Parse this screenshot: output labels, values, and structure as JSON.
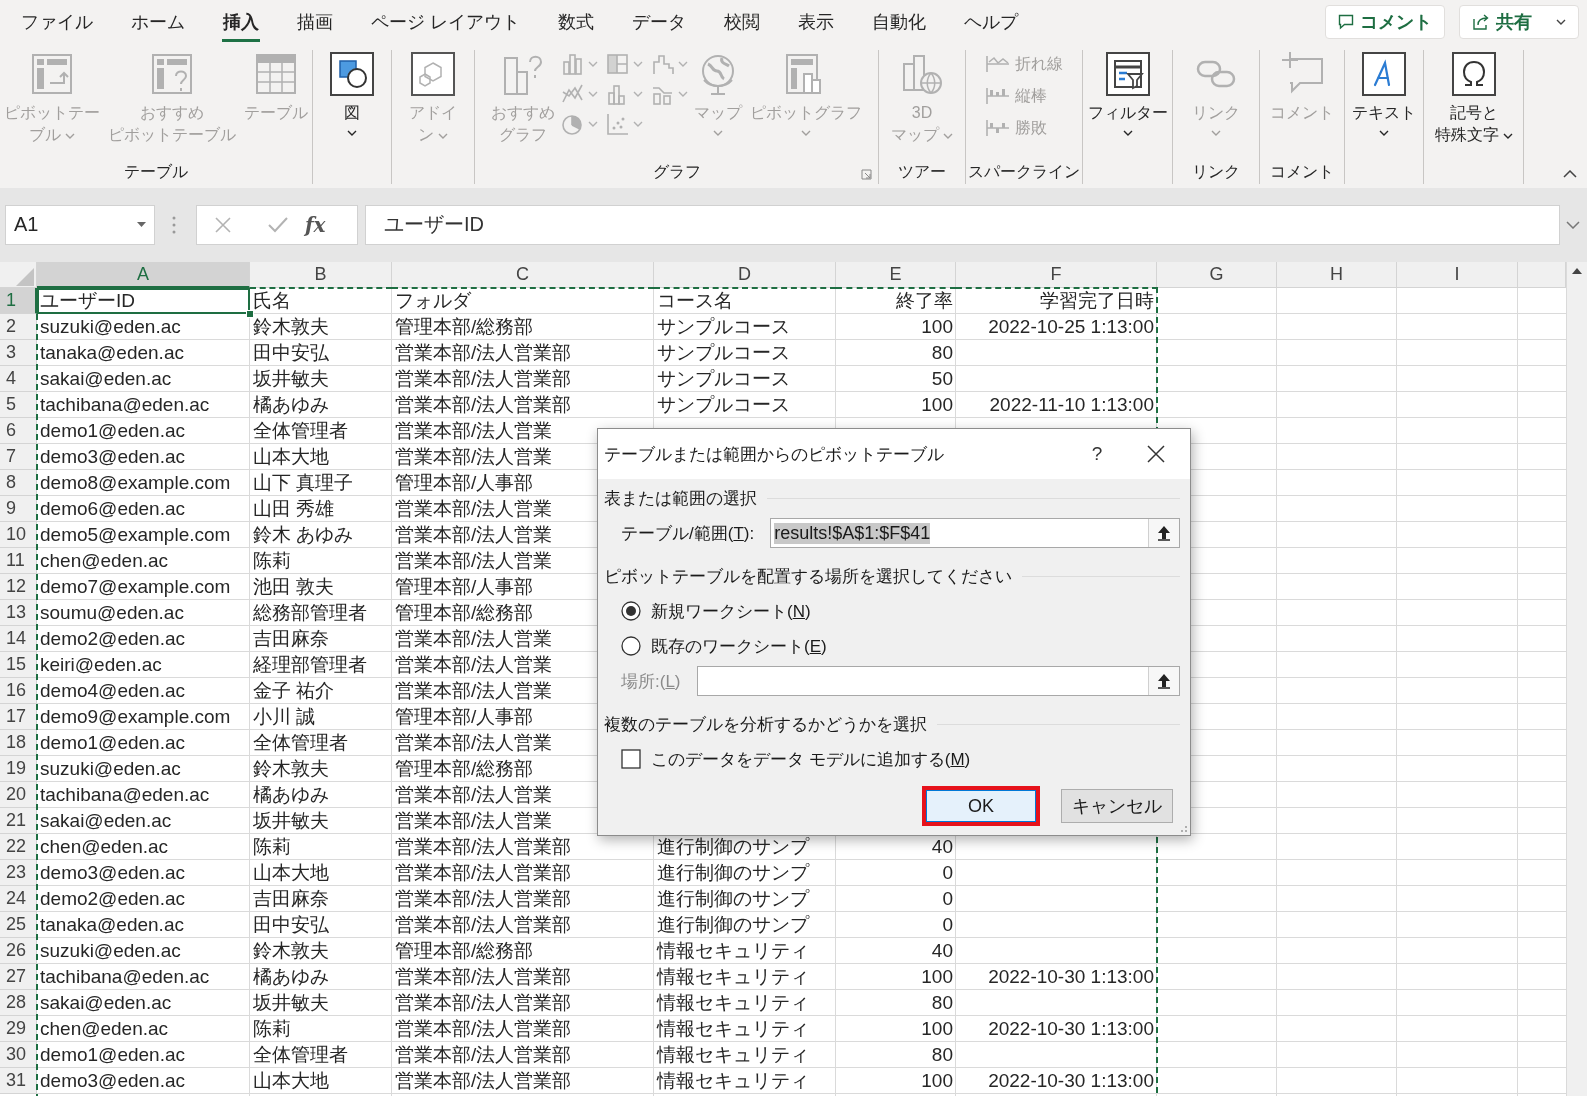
{
  "ribbon_tabs": [
    {
      "label": "ファイル",
      "selected": false
    },
    {
      "label": "ホーム",
      "selected": false
    },
    {
      "label": "挿入",
      "selected": true
    },
    {
      "label": "描画",
      "selected": false
    },
    {
      "label": "ページ レイアウト",
      "selected": false
    },
    {
      "label": "数式",
      "selected": false
    },
    {
      "label": "データ",
      "selected": false
    },
    {
      "label": "校閲",
      "selected": false
    },
    {
      "label": "表示",
      "selected": false
    },
    {
      "label": "自動化",
      "selected": false
    },
    {
      "label": "ヘルプ",
      "selected": false
    }
  ],
  "header_buttons": [
    {
      "kind": "comment",
      "label": "コメント",
      "dropdown": false
    },
    {
      "kind": "share",
      "label": "共有",
      "dropdown": true
    }
  ],
  "ribbon": {
    "groups": [
      {
        "label": "テーブル",
        "items": [
          {
            "kind": "large_inline",
            "label_lines": [
              "ピボットテー",
              "ブル"
            ],
            "dropdown": true,
            "disabled": true
          },
          {
            "kind": "large",
            "label_lines": [
              "おすすめ",
              "ピボットテーブル"
            ],
            "disabled": true
          },
          {
            "kind": "large",
            "label_lines": [
              "テーブル"
            ],
            "disabled": true
          }
        ]
      },
      {
        "items": [
          {
            "kind": "large",
            "label_lines": [
              "図"
            ],
            "dropdown": true,
            "disabled": false
          }
        ]
      },
      {
        "items": [
          {
            "kind": "large_inline",
            "label_lines": [
              "アドイ",
              "ン"
            ],
            "dropdown": true,
            "disabled": true
          }
        ]
      },
      {
        "label": "グラフ",
        "launcher": true,
        "items": [
          {
            "kind": "large",
            "label_lines": [
              "おすすめ",
              "グラフ"
            ],
            "disabled": true
          },
          {
            "kind": "chart_grid",
            "disabled": true
          },
          {
            "kind": "large",
            "label_lines": [
              "マップ"
            ],
            "dropdown": true,
            "disabled": true
          },
          {
            "kind": "large",
            "label_lines": [
              "ピボットグラフ"
            ],
            "dropdown": true,
            "disabled": true
          }
        ]
      },
      {
        "label": "ツアー",
        "items": [
          {
            "kind": "large_inline",
            "label_lines": [
              "3D",
              "マップ"
            ],
            "dropdown": true,
            "disabled": true
          }
        ]
      },
      {
        "label": "スパークライン",
        "items": [
          {
            "kind": "small",
            "label_lines": [
              "折れ線"
            ],
            "disabled": true
          },
          {
            "kind": "small",
            "label_lines": [
              "縦棒"
            ],
            "disabled": true
          },
          {
            "kind": "small",
            "label_lines": [
              "勝敗"
            ],
            "disabled": true
          }
        ]
      },
      {
        "items": [
          {
            "kind": "large",
            "label_lines": [
              "フィルター"
            ],
            "dropdown": true,
            "disabled": false
          }
        ]
      },
      {
        "label": "リンク",
        "items": [
          {
            "kind": "large",
            "label_lines": [
              "リンク"
            ],
            "dropdown": true,
            "disabled": true
          }
        ]
      },
      {
        "label": "コメント",
        "items": [
          {
            "kind": "large",
            "label_lines": [
              "コメント"
            ],
            "disabled": true
          }
        ]
      },
      {
        "items": [
          {
            "kind": "large",
            "label_lines": [
              "テキスト"
            ],
            "dropdown": true,
            "disabled": false
          }
        ]
      },
      {
        "items": [
          {
            "kind": "large_inline",
            "label_lines": [
              "記号と",
              "特殊文字"
            ],
            "dropdown": true,
            "disabled": false
          }
        ]
      }
    ]
  },
  "formula_bar": {
    "name_box": "A1",
    "function_label": "fx",
    "formula": "ユーザーID"
  },
  "sheet": {
    "columns": [
      {
        "label": "A",
        "selected": true,
        "in_copy_range": true,
        "kind": "text"
      },
      {
        "label": "B",
        "selected": false,
        "in_copy_range": true,
        "kind": "text"
      },
      {
        "label": "C",
        "selected": false,
        "in_copy_range": true,
        "kind": "text"
      },
      {
        "label": "D",
        "selected": false,
        "in_copy_range": true,
        "kind": "text"
      },
      {
        "label": "E",
        "selected": false,
        "in_copy_range": true,
        "kind": "number"
      },
      {
        "label": "F",
        "selected": false,
        "in_copy_range": true,
        "kind": "datetime"
      },
      {
        "label": "G",
        "selected": false,
        "in_copy_range": false,
        "kind": "text"
      },
      {
        "label": "H",
        "selected": false,
        "in_copy_range": false,
        "kind": "text"
      },
      {
        "label": "I",
        "selected": false,
        "in_copy_range": false,
        "kind": "text"
      }
    ],
    "rows": [
      {
        "number": "1",
        "selected": true,
        "cells": {
          "A": "ユーザーID",
          "B": "氏名",
          "C": "フォルダ",
          "D": "コース名",
          "E": "終了率",
          "F": "学習完了日時"
        }
      },
      {
        "number": "2",
        "selected": false,
        "cells": {
          "A": "suzuki@eden.ac",
          "B": "鈴木敦夫",
          "C": "管理本部/総務部",
          "D": "サンプルコース",
          "E": "100",
          "F": "2022-10-25 1:13:00"
        }
      },
      {
        "number": "3",
        "selected": false,
        "cells": {
          "A": "tanaka@eden.ac",
          "B": "田中安弘",
          "C": "営業本部/法人営業部",
          "D": "サンプルコース",
          "E": "80"
        }
      },
      {
        "number": "4",
        "selected": false,
        "cells": {
          "A": "sakai@eden.ac",
          "B": "坂井敏夫",
          "C": "営業本部/法人営業部",
          "D": "サンプルコース",
          "E": "50"
        }
      },
      {
        "number": "5",
        "selected": false,
        "cells": {
          "A": "tachibana@eden.ac",
          "B": "橘あゆみ",
          "C": "営業本部/法人営業部",
          "D": "サンプルコース",
          "E": "100",
          "F": "2022-11-10 1:13:00"
        }
      },
      {
        "number": "6",
        "selected": false,
        "cells": {
          "A": "demo1@eden.ac",
          "B": "全体管理者",
          "C": "営業本部/法人営業"
        }
      },
      {
        "number": "7",
        "selected": false,
        "cells": {
          "A": "demo3@eden.ac",
          "B": "山本大地",
          "C": "営業本部/法人営業"
        }
      },
      {
        "number": "8",
        "selected": false,
        "cells": {
          "A": "demo8@example.com",
          "B": "山下 真理子",
          "C": "管理本部/人事部"
        }
      },
      {
        "number": "9",
        "selected": false,
        "cells": {
          "A": "demo6@eden.ac",
          "B": "山田 秀雄",
          "C": "営業本部/法人営業"
        }
      },
      {
        "number": "10",
        "selected": false,
        "cells": {
          "A": "demo5@example.com",
          "B": "鈴木 あゆみ",
          "C": "営業本部/法人営業"
        }
      },
      {
        "number": "11",
        "selected": false,
        "cells": {
          "A": "chen@eden.ac",
          "B": "陈莉",
          "C": "営業本部/法人営業"
        }
      },
      {
        "number": "12",
        "selected": false,
        "cells": {
          "A": "demo7@example.com",
          "B": "池田 敦夫",
          "C": "管理本部/人事部"
        }
      },
      {
        "number": "13",
        "selected": false,
        "cells": {
          "A": "soumu@eden.ac",
          "B": "総務部管理者",
          "C": "管理本部/総務部"
        }
      },
      {
        "number": "14",
        "selected": false,
        "cells": {
          "A": "demo2@eden.ac",
          "B": "吉田麻奈",
          "C": "営業本部/法人営業"
        }
      },
      {
        "number": "15",
        "selected": false,
        "cells": {
          "A": "keiri@eden.ac",
          "B": "経理部管理者",
          "C": "営業本部/法人営業"
        }
      },
      {
        "number": "16",
        "selected": false,
        "cells": {
          "A": "demo4@eden.ac",
          "B": "金子 祐介",
          "C": "営業本部/法人営業"
        }
      },
      {
        "number": "17",
        "selected": false,
        "cells": {
          "A": "demo9@example.com",
          "B": "小川 誠",
          "C": "管理本部/人事部"
        }
      },
      {
        "number": "18",
        "selected": false,
        "cells": {
          "A": "demo1@eden.ac",
          "B": "全体管理者",
          "C": "営業本部/法人営業"
        }
      },
      {
        "number": "19",
        "selected": false,
        "cells": {
          "A": "suzuki@eden.ac",
          "B": "鈴木敦夫",
          "C": "管理本部/総務部"
        }
      },
      {
        "number": "20",
        "selected": false,
        "cells": {
          "A": "tachibana@eden.ac",
          "B": "橘あゆみ",
          "C": "営業本部/法人営業"
        }
      },
      {
        "number": "21",
        "selected": false,
        "cells": {
          "A": "sakai@eden.ac",
          "B": "坂井敏夫",
          "C": "営業本部/法人営業"
        }
      },
      {
        "number": "22",
        "selected": false,
        "cells": {
          "A": "chen@eden.ac",
          "B": "陈莉",
          "C": "営業本部/法人営業部",
          "D": "進行制御のサンプ",
          "E": "40"
        }
      },
      {
        "number": "23",
        "selected": false,
        "cells": {
          "A": "demo3@eden.ac",
          "B": "山本大地",
          "C": "営業本部/法人営業部",
          "D": "進行制御のサンプ",
          "E": "0"
        }
      },
      {
        "number": "24",
        "selected": false,
        "cells": {
          "A": "demo2@eden.ac",
          "B": "吉田麻奈",
          "C": "営業本部/法人営業部",
          "D": "進行制御のサンプ",
          "E": "0"
        }
      },
      {
        "number": "25",
        "selected": false,
        "cells": {
          "A": "tanaka@eden.ac",
          "B": "田中安弘",
          "C": "営業本部/法人営業部",
          "D": "進行制御のサンプ",
          "E": "0"
        }
      },
      {
        "number": "26",
        "selected": false,
        "cells": {
          "A": "suzuki@eden.ac",
          "B": "鈴木敦夫",
          "C": "管理本部/総務部",
          "D": "情報セキュリティ",
          "E": "40"
        }
      },
      {
        "number": "27",
        "selected": false,
        "cells": {
          "A": "tachibana@eden.ac",
          "B": "橘あゆみ",
          "C": "営業本部/法人営業部",
          "D": "情報セキュリティ",
          "E": "100",
          "F": "2022-10-30 1:13:00"
        }
      },
      {
        "number": "28",
        "selected": false,
        "cells": {
          "A": "sakai@eden.ac",
          "B": "坂井敏夫",
          "C": "営業本部/法人営業部",
          "D": "情報セキュリティ",
          "E": "80"
        }
      },
      {
        "number": "29",
        "selected": false,
        "cells": {
          "A": "chen@eden.ac",
          "B": "陈莉",
          "C": "営業本部/法人営業部",
          "D": "情報セキュリティ",
          "E": "100",
          "F": "2022-10-30 1:13:00"
        }
      },
      {
        "number": "30",
        "selected": false,
        "cells": {
          "A": "demo1@eden.ac",
          "B": "全体管理者",
          "C": "営業本部/法人営業部",
          "D": "情報セキュリティ",
          "E": "80"
        }
      },
      {
        "number": "31",
        "selected": false,
        "cells": {
          "A": "demo3@eden.ac",
          "B": "山本大地",
          "C": "営業本部/法人営業部",
          "D": "情報セキュリティ",
          "E": "100",
          "F": "2022-10-30 1:13:00"
        }
      }
    ]
  },
  "dialog": {
    "title": "テーブルまたは範囲からのピボットテーブル",
    "help": "?",
    "sections": [
      {
        "heading": "表または範囲の選択",
        "fields": [
          {
            "label_parts": [
              "テーブル/範囲(",
              "T",
              "):"
            ],
            "value": "results!$A$1:$F$41",
            "value_selected": true,
            "disabled": false
          }
        ]
      },
      {
        "heading": "ピボットテーブルを配置する場所を選択してください",
        "options": [
          {
            "kind": "radio",
            "label_parts": [
              "新規ワークシート(",
              "N",
              ")"
            ],
            "selected": true
          },
          {
            "kind": "radio",
            "label_parts": [
              "既存のワークシート(",
              "E",
              ")"
            ],
            "selected": false
          }
        ],
        "fields": [
          {
            "label_parts": [
              "場所:(",
              "L",
              ")"
            ],
            "disabled": true
          }
        ]
      },
      {
        "heading": "複数のテーブルを分析するかどうかを選択",
        "options": [
          {
            "kind": "checkbox",
            "label_parts": [
              "このデータをデータ モデルに追加する(",
              "M",
              ")"
            ],
            "checked": false
          }
        ]
      }
    ],
    "buttons": [
      {
        "label": "OK",
        "default": true,
        "highlighted": true
      },
      {
        "label": "キャンセル",
        "default": false,
        "highlighted": false
      }
    ]
  }
}
